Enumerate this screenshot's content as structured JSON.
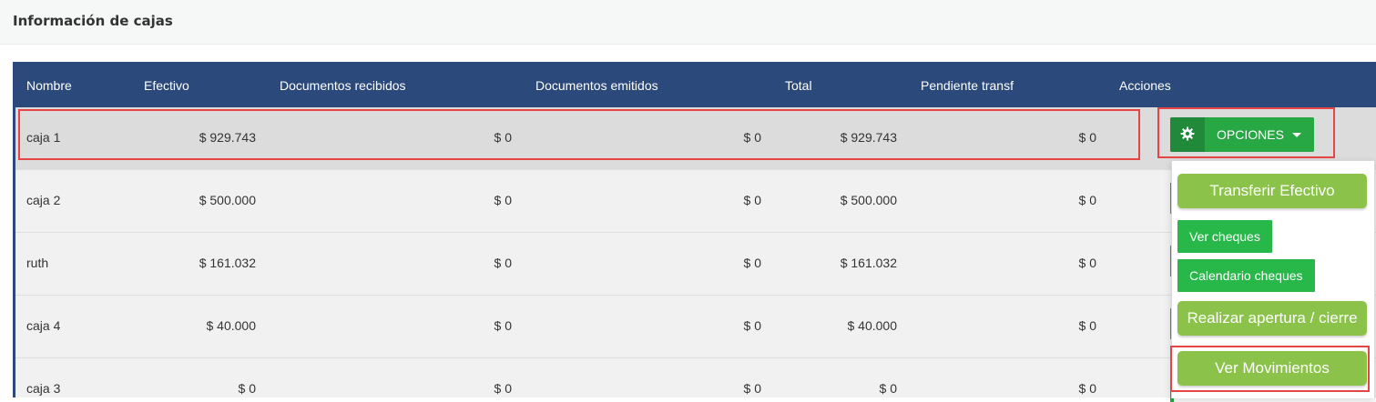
{
  "panel": {
    "title": "Información de cajas"
  },
  "table": {
    "headers": [
      "Nombre",
      "Efectivo",
      "Documentos recibidos",
      "Documentos emitidos",
      "Total",
      "Pendiente transf",
      "Acciones"
    ],
    "rows": [
      [
        "caja 1",
        "$ 929.743",
        "$ 0",
        "$ 0",
        "$ 929.743",
        "$ 0"
      ],
      [
        "caja 2",
        "$ 500.000",
        "$ 0",
        "$ 0",
        "$ 500.000",
        "$ 0"
      ],
      [
        "ruth",
        "$ 161.032",
        "$ 0",
        "$ 0",
        "$ 161.032",
        "$ 0"
      ],
      [
        "caja 4",
        "$ 40.000",
        "$ 0",
        "$ 0",
        "$ 40.000",
        "$ 0"
      ],
      [
        "caja 3",
        "$ 0",
        "$ 0",
        "$ 0",
        "$ 0",
        "$ 0"
      ]
    ]
  },
  "actions": {
    "options_label": "OPCIONES",
    "menu": {
      "transferir": "Transferir Efectivo",
      "ver_cheques": "Ver cheques",
      "calendario": "Calendario cheques",
      "apertura": "Realizar apertura / cierre",
      "movimientos": "Ver Movimientos"
    }
  },
  "colors": {
    "header_bg": "#2b4a7b",
    "options_green": "#28a745",
    "menu_light_green": "#8bc34a",
    "highlight_red": "#e64545"
  }
}
